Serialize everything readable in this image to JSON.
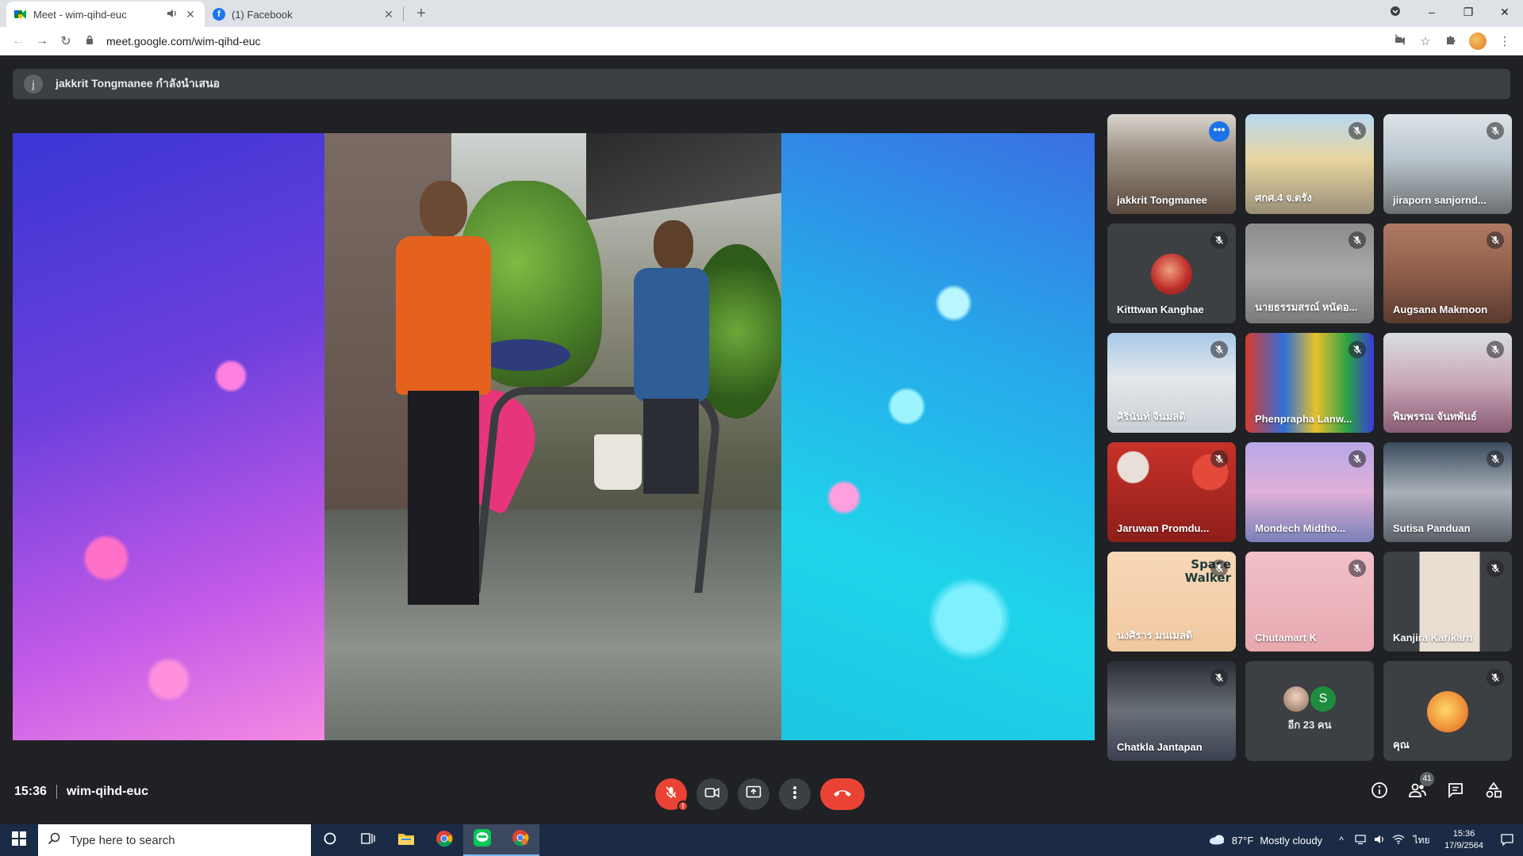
{
  "browser": {
    "tabs": [
      {
        "title": "Meet - wim-qihd-euc",
        "favicon": "google-meet-icon",
        "audio": true,
        "active": true
      },
      {
        "title": "(1) Facebook",
        "favicon": "facebook-icon",
        "audio": false,
        "active": false
      }
    ],
    "new_tab_label": "+",
    "url": "meet.google.com/wim-qihd-euc"
  },
  "meet": {
    "presenter_initial": "j",
    "presenting_banner": "jakkrit Tongmanee กำลังนำเสนอ",
    "participants": [
      {
        "name": "jakkrit Tongmanee",
        "muted": false,
        "speaking": true
      },
      {
        "name": "ศกศ.4 จ.ตรัง",
        "muted": true
      },
      {
        "name": "jiraporn sanjornd...",
        "muted": true
      },
      {
        "name": "Kitttwan Kanghae",
        "muted": true,
        "avatar": true
      },
      {
        "name": "นายธรรมสรณ์ หนัดอ...",
        "muted": true
      },
      {
        "name": "Augsana Makmoon",
        "muted": true
      },
      {
        "name": "ศิรินันท์ จินมลดิ",
        "muted": true
      },
      {
        "name": "Phenprapha Lanw...",
        "muted": true
      },
      {
        "name": "พิมพรรณ จันทพันธ์",
        "muted": true
      },
      {
        "name": "Jaruwan Promdu...",
        "muted": true
      },
      {
        "name": "Mondech Midtho...",
        "muted": true
      },
      {
        "name": "Sutisa Panduan",
        "muted": true
      },
      {
        "name": "นงศิราร มนเมลดิ",
        "muted": true,
        "sign_text": "Space Walker"
      },
      {
        "name": "Chutamart K",
        "muted": true
      },
      {
        "name": "Kanjira Karikarn",
        "muted": true
      },
      {
        "name": "Chatkla Jantapan",
        "muted": true
      },
      {
        "name": "",
        "more_label": "อีก 23 คน",
        "more_avatar_letter": "S"
      },
      {
        "name": "คุณ",
        "muted": true,
        "avatar": true
      }
    ],
    "clock": "15:36",
    "meeting_code": "wim-qihd-euc",
    "people_count": "41"
  },
  "taskbar": {
    "search_placeholder": "Type here to search",
    "weather_temp": "87°F",
    "weather_text": "Mostly cloudy",
    "language": "ไทย",
    "time": "15:36",
    "date": "17/9/2564"
  },
  "colors": {
    "meet_bg": "#202124",
    "tile_bg": "#3c4043",
    "end_call_red": "#ea4335",
    "speaking_blue": "#8ab4f8",
    "taskbar": "#1b2b45"
  }
}
